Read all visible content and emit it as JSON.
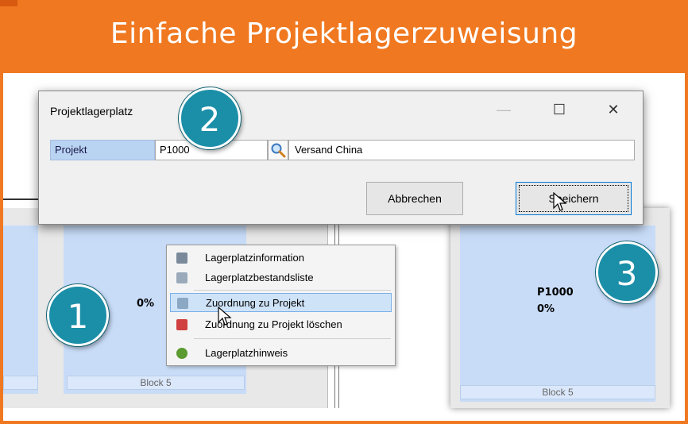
{
  "banner": {
    "title": "Einfache Projektlagerzuweisung"
  },
  "dialog": {
    "title": "Projektlagerplatz",
    "minimize_glyph": "—",
    "maximize_glyph": "☐",
    "close_glyph": "✕",
    "field_label": "Projekt",
    "project_value": "P1000",
    "description_value": "Versand China",
    "cancel_label": "Abbrechen",
    "save_label": "Speichern"
  },
  "left_view": {
    "cell_percent": "0%",
    "cell_footer": "Block 5"
  },
  "context_menu": {
    "items": [
      {
        "label": "Lagerplatzinformation",
        "icon": "info-sheet-icon"
      },
      {
        "label": "Lagerplatzbestandsliste",
        "icon": "stock-list-icon"
      },
      {
        "label": "Zuordnung zu Projekt",
        "icon": "assign-project-icon",
        "selected": true
      },
      {
        "label": "Zuordnung zu Projekt löschen",
        "icon": "delete-assignment-icon"
      },
      {
        "label": "Lagerplatzhinweis",
        "icon": "hint-icon"
      }
    ]
  },
  "right_view": {
    "project": "P1000",
    "percent": "0%",
    "cell_footer": "Block 5"
  },
  "badges": [
    "1",
    "2",
    "3"
  ],
  "colors": {
    "banner": "#f07820",
    "badge": "#1b8fa8",
    "cell": "#c8dcf8",
    "selection": "#cfe3f8"
  }
}
